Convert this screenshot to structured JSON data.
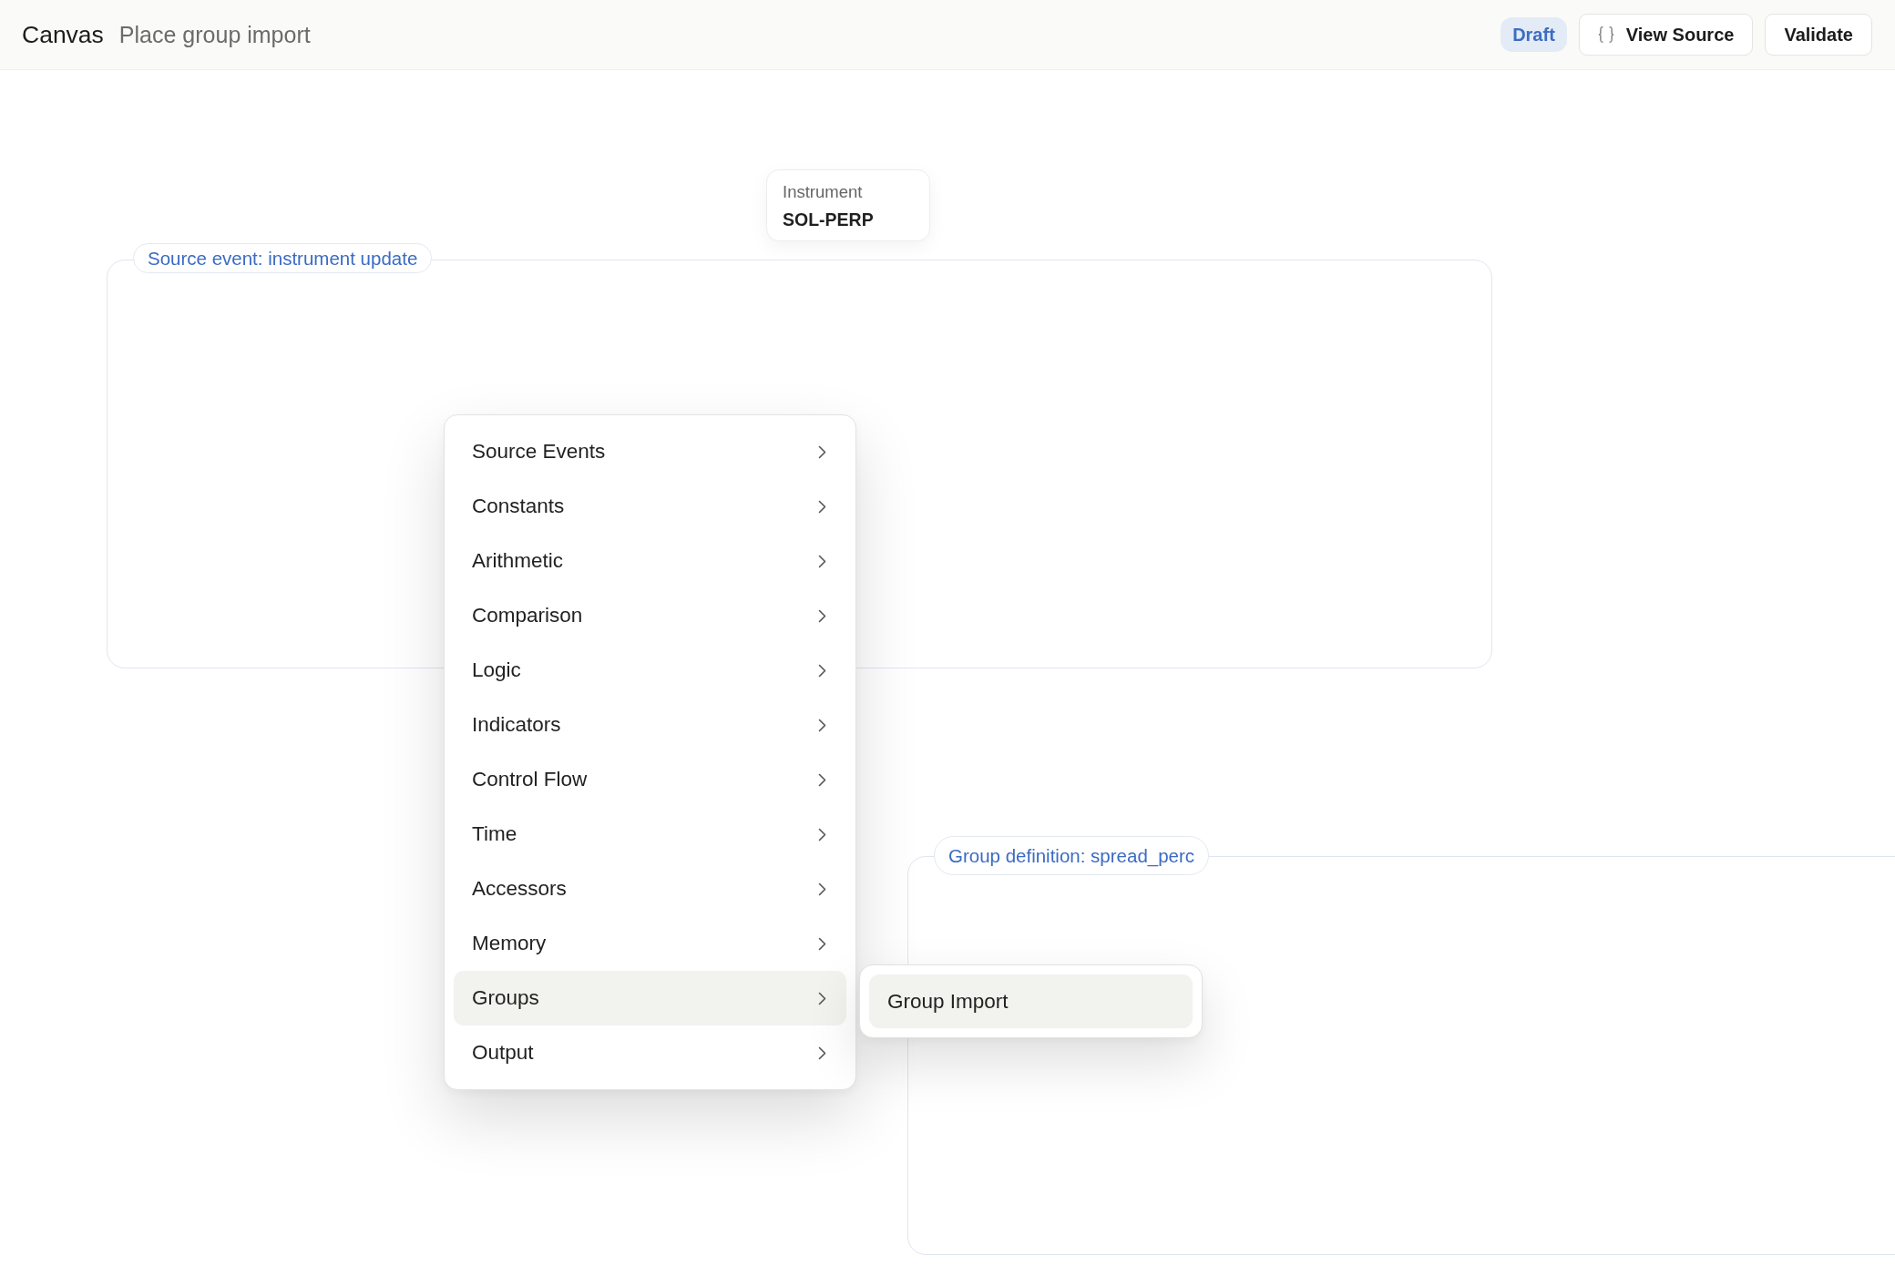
{
  "header": {
    "title": "Canvas",
    "subtitle": "Place group import",
    "status_badge": "Draft",
    "buttons": [
      {
        "label": "View Source",
        "kind": "code"
      },
      {
        "label": "Validate",
        "kind": "plain"
      }
    ]
  },
  "canvas": {
    "nodes": [
      {
        "kind": "instrument",
        "label": "Instrument",
        "value": "SOL-PERP"
      }
    ],
    "groups": [
      {
        "label": "Source event: instrument update"
      },
      {
        "label": "Group definition: spread_perc"
      }
    ]
  },
  "context_menu": {
    "items": [
      {
        "label": "Source Events",
        "has_submenu": true,
        "selected": false
      },
      {
        "label": "Constants",
        "has_submenu": true,
        "selected": false
      },
      {
        "label": "Arithmetic",
        "has_submenu": true,
        "selected": false
      },
      {
        "label": "Comparison",
        "has_submenu": true,
        "selected": false
      },
      {
        "label": "Logic",
        "has_submenu": true,
        "selected": false
      },
      {
        "label": "Indicators",
        "has_submenu": true,
        "selected": false
      },
      {
        "label": "Control Flow",
        "has_submenu": true,
        "selected": false
      },
      {
        "label": "Time",
        "has_submenu": true,
        "selected": false
      },
      {
        "label": "Accessors",
        "has_submenu": true,
        "selected": false
      },
      {
        "label": "Memory",
        "has_submenu": true,
        "selected": false
      },
      {
        "label": "Groups",
        "has_submenu": true,
        "selected": true
      },
      {
        "label": "Output",
        "has_submenu": true,
        "selected": false
      }
    ]
  },
  "submenu": {
    "items": [
      {
        "label": "Group Import",
        "selected": true
      }
    ]
  }
}
